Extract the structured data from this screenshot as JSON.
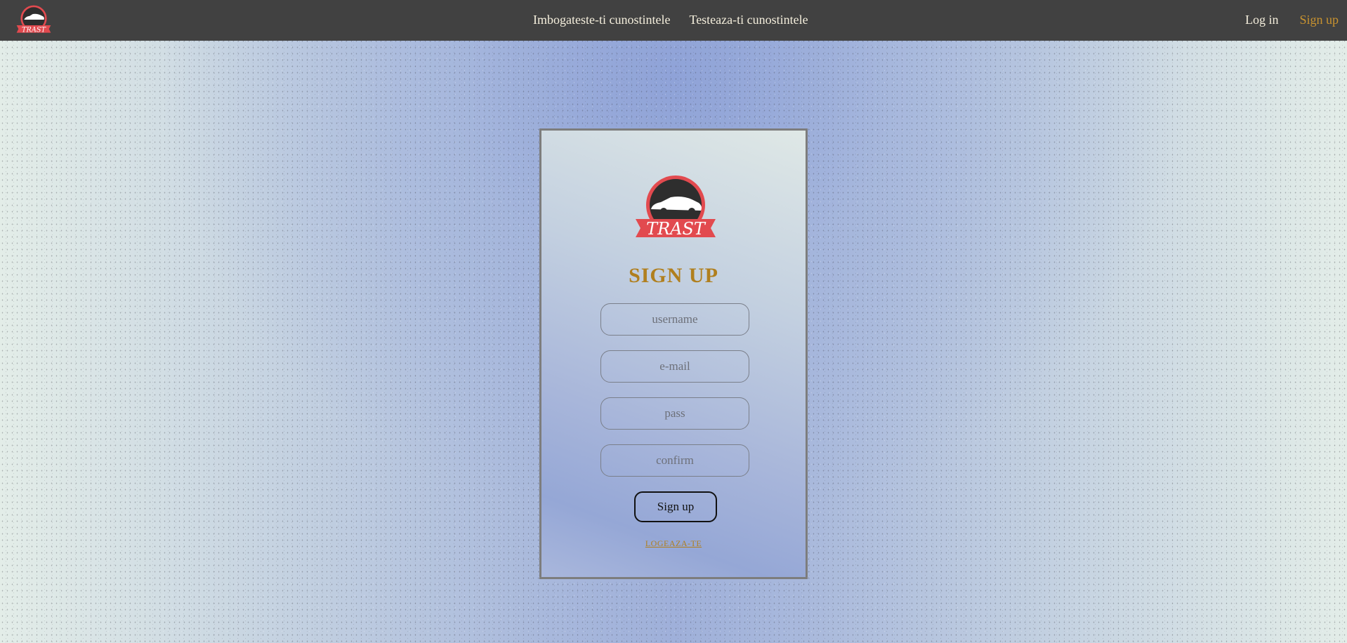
{
  "navbar": {
    "logo_text": "TRAST",
    "links": [
      {
        "label": "Imbogateste-ti cunostintele"
      },
      {
        "label": "Testeaza-ti cunostintele"
      }
    ],
    "login_label": "Log in",
    "signup_label": "Sign up"
  },
  "form": {
    "logo_text": "TRAST",
    "title": "SIGN UP",
    "username_placeholder": "username",
    "email_placeholder": "e-mail",
    "pass_placeholder": "pass",
    "confirm_placeholder": "confirm",
    "submit_label": "Sign up",
    "login_link": "LOGEAZA-TE"
  },
  "colors": {
    "navbar_bg": "#414141",
    "accent": "#b07f1e",
    "logo_red": "#e24a4f",
    "logo_dark": "#2e2e2e"
  }
}
